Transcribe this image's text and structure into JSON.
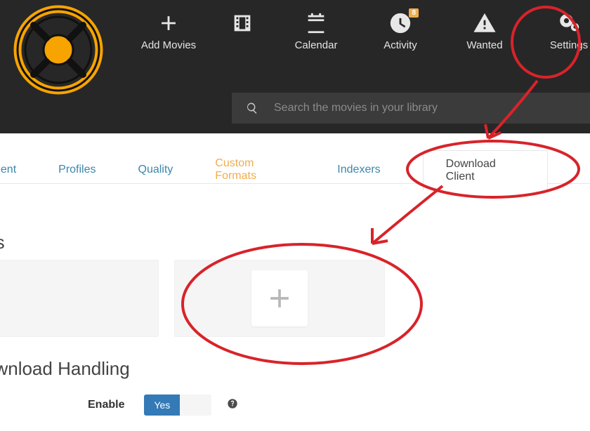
{
  "nav": {
    "add_movies": "Add Movies",
    "calendar": "Calendar",
    "activity": "Activity",
    "activity_badge": "8",
    "wanted": "Wanted",
    "settings": "Settings"
  },
  "search": {
    "placeholder": "Search the movies in your library"
  },
  "tabs": {
    "partial_left": "nent",
    "profiles": "Profiles",
    "quality": "Quality",
    "custom_formats": "Custom Formats",
    "indexers": "Indexers",
    "download_client": "Download Client"
  },
  "sections": {
    "clients_title": "nts",
    "download_handling": "ownload Handling"
  },
  "form": {
    "enable_label": "Enable",
    "enable_on": "Yes"
  },
  "colors": {
    "accent_blue": "#337ab7",
    "accent_orange": "#f0ad4e",
    "link_blue": "#3a87ad",
    "annotate_red": "#d8232a"
  }
}
